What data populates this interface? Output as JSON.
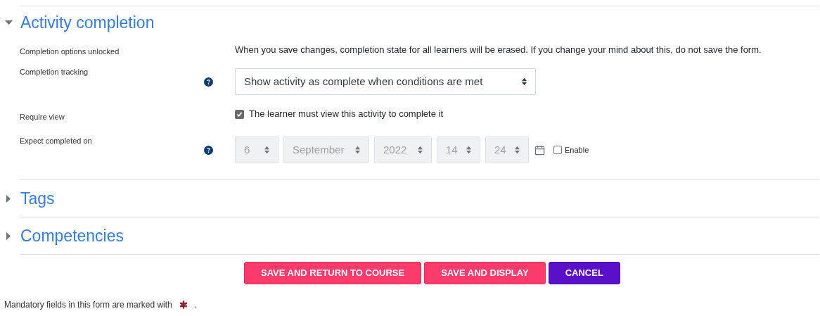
{
  "sections": [
    {
      "title": "Activity completion",
      "expanded": true,
      "rows": [
        {
          "kind": "text",
          "label": "Completion options unlocked",
          "help": false,
          "text": "When you save changes, completion state for all learners will be erased. If you change your mind about this, do not save the form."
        },
        {
          "kind": "select",
          "label": "Completion tracking",
          "help": true,
          "value": "Show activity as complete when conditions are met"
        },
        {
          "kind": "checkbox",
          "label": "Require view",
          "help": false,
          "checked": true,
          "text": "The learner must view this activity to complete it"
        },
        {
          "kind": "datetime",
          "label": "Expect completed on",
          "help": true,
          "disabled": true,
          "parts": [
            "6",
            "September",
            "2022",
            "14",
            "24"
          ],
          "enable": {
            "label": "Enable",
            "checked": false
          }
        }
      ]
    },
    {
      "title": "Tags",
      "expanded": false
    },
    {
      "title": "Competencies",
      "expanded": false
    }
  ],
  "buttons": [
    {
      "label": "SAVE AND RETURN TO COURSE",
      "kind": "primary"
    },
    {
      "label": "SAVE AND DISPLAY",
      "kind": "primary"
    },
    {
      "label": "CANCEL",
      "kind": "cancel"
    }
  ],
  "footer": {
    "text": "Mandatory fields in this form are marked with",
    "end": "."
  }
}
